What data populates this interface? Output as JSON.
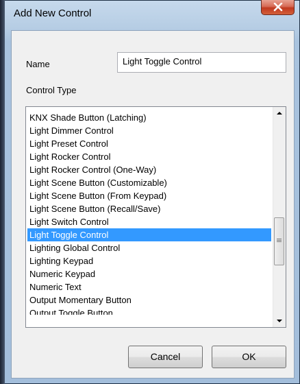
{
  "window": {
    "title": "Add New Control"
  },
  "form": {
    "name_label": "Name",
    "name_value": "Light Toggle Control",
    "control_type_label": "Control Type"
  },
  "control_types": {
    "items": [
      "KNX Shade Button (Latching)",
      "Light Dimmer Control",
      "Light Preset Control",
      "Light Rocker Control",
      "Light Rocker Control (One-Way)",
      "Light Scene Button (Customizable)",
      "Light Scene Button (From Keypad)",
      "Light Scene Button (Recall/Save)",
      "Light Switch Control",
      "Light Toggle Control",
      "Lighting Global Control",
      "Lighting Keypad",
      "Numeric Keypad",
      "Numeric Text",
      "Output Momentary Button",
      "Output Toggle Button"
    ],
    "selected": "Light Toggle Control"
  },
  "buttons": {
    "cancel": "Cancel",
    "ok": "OK"
  },
  "colors": {
    "selection": "#3399ff",
    "close_button": "#c0391f"
  },
  "icons": {
    "close": "close-icon",
    "scroll_up": "scroll-up-arrow-icon",
    "scroll_down": "scroll-down-arrow-icon"
  }
}
